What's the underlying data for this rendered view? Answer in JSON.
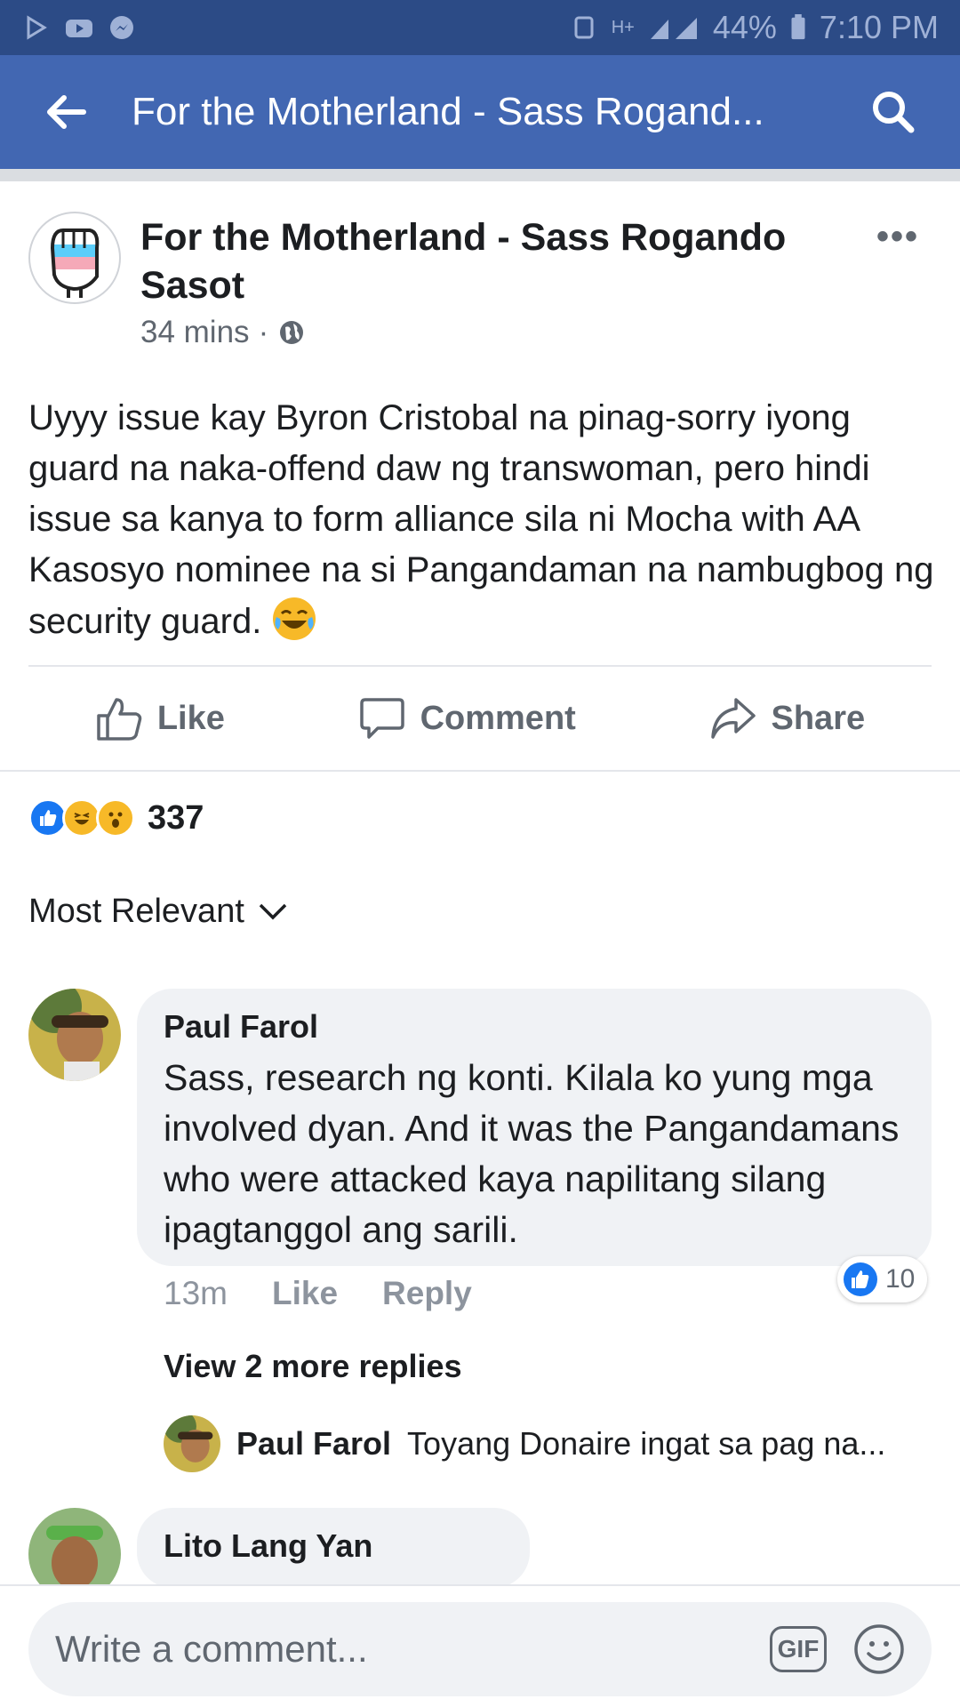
{
  "status_bar": {
    "battery": "44%",
    "time": "7:10 PM",
    "network": "H+"
  },
  "header": {
    "title": "For the Motherland - Sass Rogand...",
    "bg_color": "#4267b2"
  },
  "post": {
    "page_name": "For the Motherland - Sass Rogando Sasot",
    "time": "34 mins",
    "privacy_icon": "globe-icon",
    "more_label": "•••",
    "text": "Uyyy issue kay Byron Cristobal na pinag-sorry iyong guard na naka-offend daw ng transwoman, pero hindi issue sa kanya to form alliance sila ni Mocha with AA Kasosyo nominee na si Pangandaman na nambugbog ng security guard.",
    "actions": {
      "like": "Like",
      "comment": "Comment",
      "share": "Share"
    },
    "reactions": {
      "count": "337",
      "types": [
        "like",
        "haha",
        "wow"
      ]
    },
    "sort_label": "Most Relevant"
  },
  "comments": [
    {
      "author": "Paul Farol",
      "text": "Sass, research ng konti. Kilala ko yung mga involved dyan. And it was the Pangandamans who were attacked kaya napilitang silang ipagtanggol ang sarili.",
      "time": "13m",
      "like_label": "Like",
      "reply_label": "Reply",
      "like_count": "10",
      "view_more": "View 2 more replies",
      "reply_preview": {
        "author": "Paul Farol",
        "text": "Toyang Donaire ingat sa pag na..."
      }
    },
    {
      "author": "Lito Lang Yan"
    }
  ],
  "composer": {
    "placeholder": "Write a comment...",
    "gif_label": "GIF"
  }
}
